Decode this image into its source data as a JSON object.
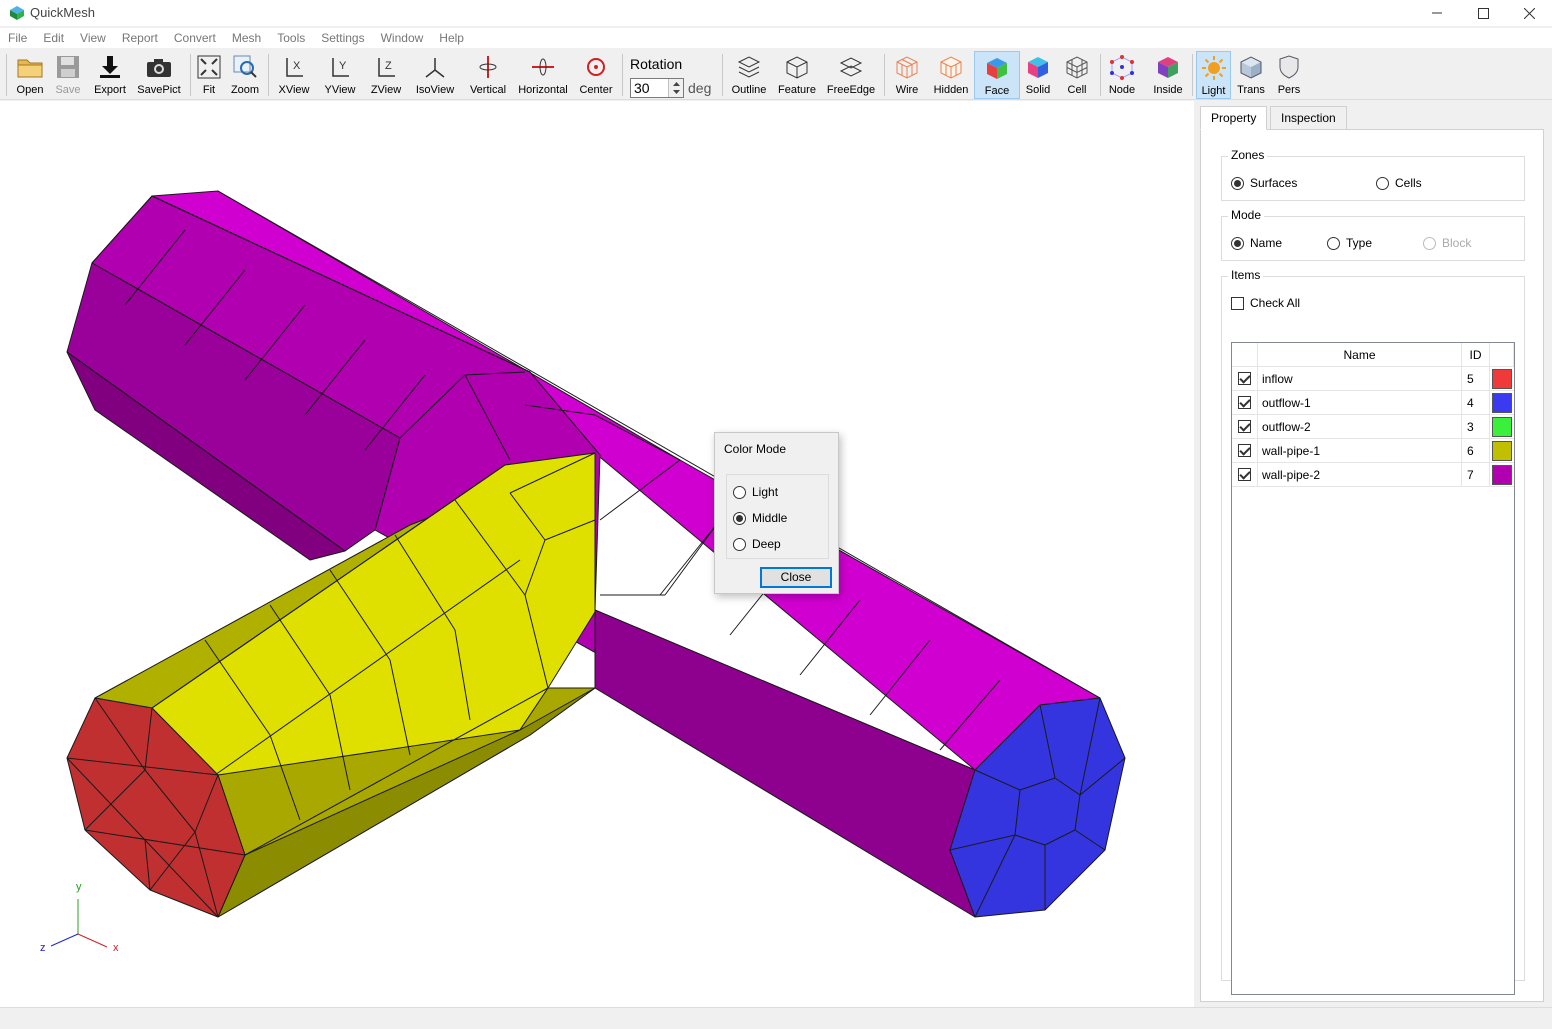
{
  "app": {
    "title": "QuickMesh"
  },
  "menu": [
    "File",
    "Edit",
    "View",
    "Report",
    "Convert",
    "Mesh",
    "Tools",
    "Settings",
    "Window",
    "Help"
  ],
  "toolbar": {
    "open": "Open",
    "save": "Save",
    "export": "Export",
    "savepict": "SavePict",
    "fit": "Fit",
    "zoom": "Zoom",
    "xview": "XView",
    "yview": "YView",
    "zview": "ZView",
    "isoview": "IsoView",
    "vertical": "Vertical",
    "horizontal": "Horizontal",
    "center": "Center",
    "rotation_label": "Rotation",
    "rotation_value": "30",
    "rotation_unit": "deg",
    "outline": "Outline",
    "feature": "Feature",
    "freeedge": "FreeEdge",
    "wire": "Wire",
    "hidden": "Hidden",
    "face": "Face",
    "solid": "Solid",
    "cell": "Cell",
    "node": "Node",
    "inside": "Inside",
    "light": "Light",
    "trans": "Trans",
    "pers": "Pers"
  },
  "panel": {
    "tabs": [
      "Property",
      "Inspection"
    ],
    "zones": {
      "title": "Zones",
      "options": [
        "Surfaces",
        "Cells"
      ],
      "selected": "Surfaces"
    },
    "mode": {
      "title": "Mode",
      "options": [
        "Name",
        "Type",
        "Block"
      ],
      "selected": "Name",
      "disabled": "Block"
    },
    "items": {
      "title": "Items",
      "check_all": "Check All",
      "columns": [
        "Name",
        "ID"
      ],
      "rows": [
        {
          "name": "inflow",
          "id": "5",
          "color": "#f03a3a",
          "checked": true
        },
        {
          "name": "outflow-1",
          "id": "4",
          "color": "#3a3af0",
          "checked": true
        },
        {
          "name": "outflow-2",
          "id": "3",
          "color": "#3af03a",
          "checked": true
        },
        {
          "name": "wall-pipe-1",
          "id": "6",
          "color": "#c0c000",
          "checked": true
        },
        {
          "name": "wall-pipe-2",
          "id": "7",
          "color": "#b000b0",
          "checked": true
        }
      ]
    }
  },
  "dialog": {
    "title": "Color Mode",
    "options": [
      "Light",
      "Middle",
      "Deep"
    ],
    "selected": "Middle",
    "close": "Close"
  },
  "axes": {
    "x": "x",
    "y": "y",
    "z": "z"
  },
  "colors": {
    "accent": "#0078d7",
    "magenta": "#d000d0",
    "yellow": "#e0e000",
    "red": "#c03030",
    "blue": "#3535e0"
  }
}
